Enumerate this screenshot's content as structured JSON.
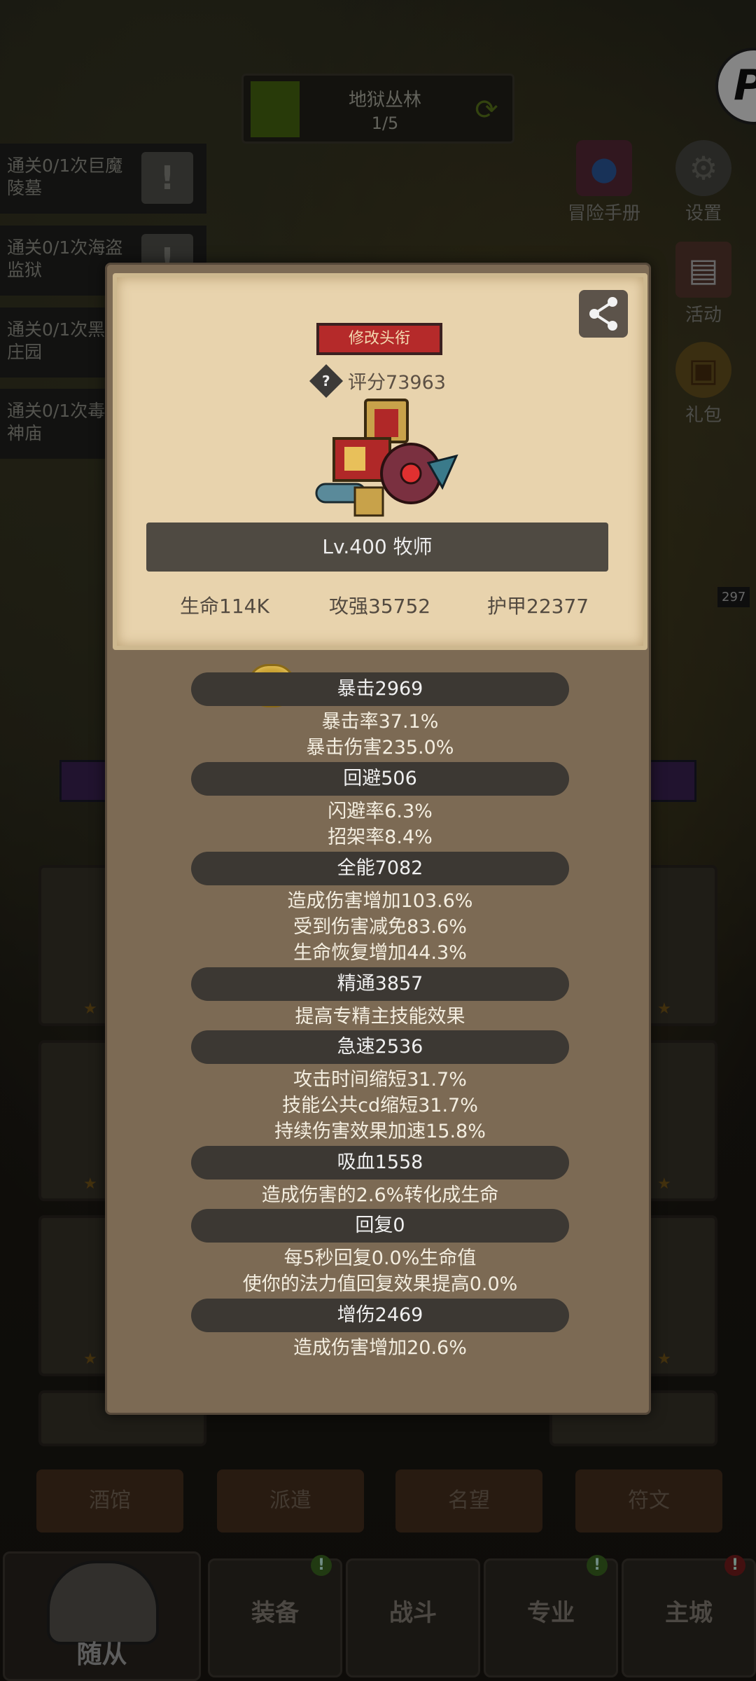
{
  "background": {
    "stage": {
      "name": "地狱丛林",
      "progress": "1/5"
    },
    "quests": [
      {
        "text": "通关0/1次巨魔陵墓"
      },
      {
        "text": "通关0/1次海盗监狱"
      },
      {
        "text": "通关0/1次黑暗庄园"
      },
      {
        "text": "通关0/1次毒蛇神庙"
      }
    ],
    "right_menu": {
      "adventure_book": "冒险手册",
      "settings": "设置",
      "events": "活动",
      "gifts": "礼包"
    },
    "hp_tag": "297",
    "tabs": [
      "酒馆",
      "派遣",
      "名望",
      "符文"
    ],
    "nav": {
      "followers": "随从",
      "equipment": "装备",
      "battle": "战斗",
      "profession": "专业",
      "main_city": "主城"
    },
    "nav_badges": {
      "equipment": "!",
      "profession": "!",
      "main_city": "!"
    }
  },
  "profile": {
    "change_title_button": "修改头衔",
    "score": "评分73963",
    "score_help": "?",
    "level_class": "Lv.400 牧师",
    "hp": "生命114K",
    "attack": "攻强35752",
    "armor": "护甲22377"
  },
  "stats": [
    {
      "title": "暴击2969",
      "details": [
        "暴击率37.1%",
        "暴击伤害235.0%"
      ]
    },
    {
      "title": "回避506",
      "details": [
        "闪避率6.3%",
        "招架率8.4%"
      ]
    },
    {
      "title": "全能7082",
      "details": [
        "造成伤害增加103.6%",
        "受到伤害减免83.6%",
        "生命恢复增加44.3%"
      ]
    },
    {
      "title": "精通3857",
      "details": [
        "提高专精主技能效果"
      ]
    },
    {
      "title": "急速2536",
      "details": [
        "攻击时间缩短31.7%",
        "技能公共cd缩短31.7%",
        "持续伤害效果加速15.8%"
      ]
    },
    {
      "title": "吸血1558",
      "details": [
        "造成伤害的2.6%转化成生命"
      ]
    },
    {
      "title": "回复0",
      "details": [
        "每5秒回复0.0%生命值",
        "使你的法力值回复效果提高0.0%"
      ]
    },
    {
      "title": "增伤2469",
      "details": [
        "造成伤害增加20.6%"
      ]
    }
  ]
}
